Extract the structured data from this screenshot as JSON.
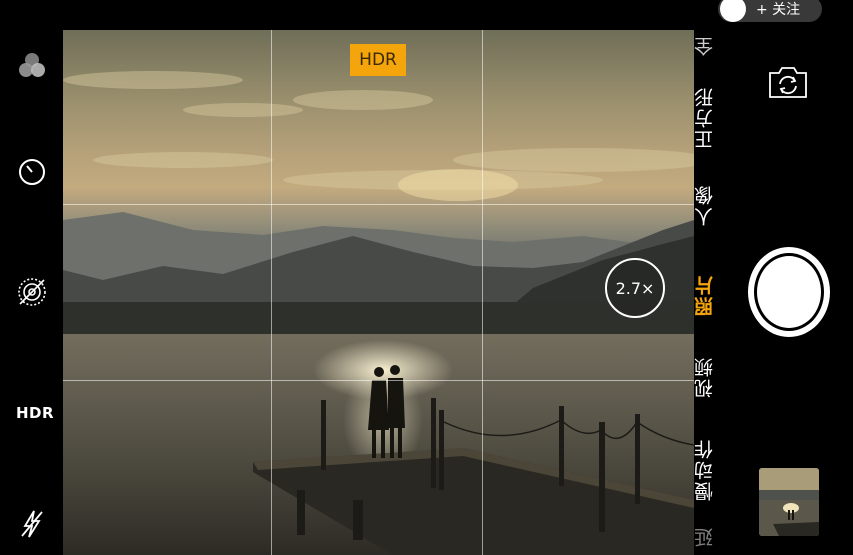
{
  "left_toolbar": {
    "hdr_label": "HDR",
    "icons": [
      "filters-icon",
      "timer-icon",
      "live-photo-off-icon",
      "flash-off-icon"
    ]
  },
  "viewfinder": {
    "hdr_badge": "HDR",
    "zoom_label": "2.7×",
    "grid": true
  },
  "follow": {
    "label": "+ 关注"
  },
  "modes": [
    {
      "label": "全",
      "active": false
    },
    {
      "label": "正方形",
      "active": false
    },
    {
      "label": "人像",
      "active": false
    },
    {
      "label": "照片",
      "active": true
    },
    {
      "label": "视频",
      "active": false
    },
    {
      "label": "慢动作",
      "active": false
    },
    {
      "label": "延",
      "active": false
    }
  ],
  "colors": {
    "accent": "#f5a50c",
    "background": "#000000"
  }
}
